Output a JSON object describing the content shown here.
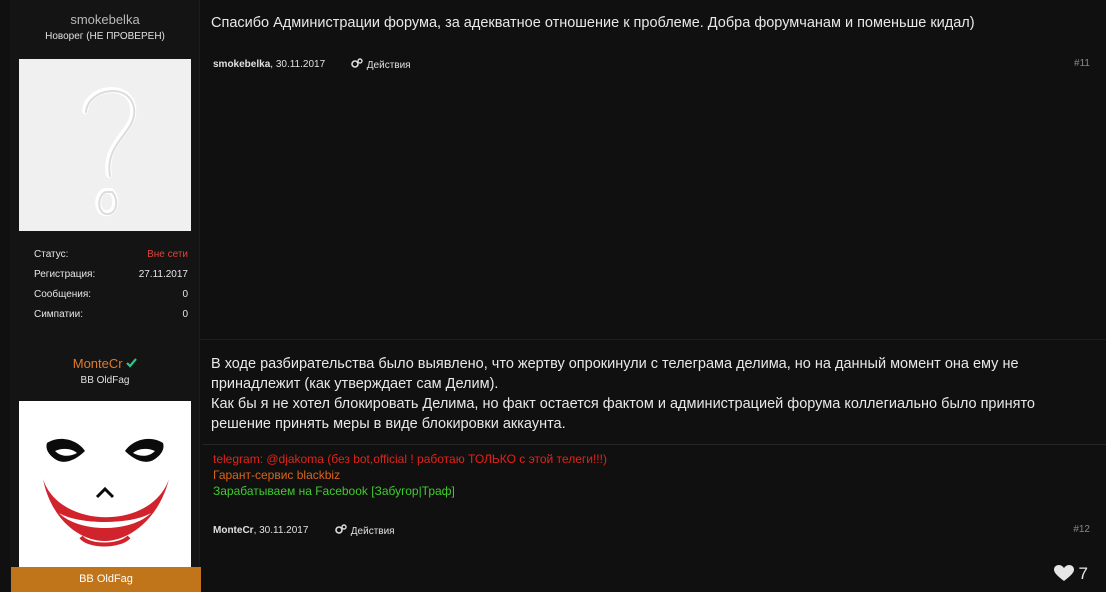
{
  "posts": [
    {
      "username": "smokebelka",
      "user_title": "Новорег (НЕ ПРОВЕРЕН)",
      "avatar_icon": "question-mark-avatar",
      "info": [
        {
          "label": "Статус:",
          "value": "Вне сети"
        },
        {
          "label": "Регистрация:",
          "value": "27.11.2017"
        },
        {
          "label": "Сообщения:",
          "value": "0"
        },
        {
          "label": "Симпатии:",
          "value": "0"
        }
      ],
      "message": "Спасибо Администрации форума, за адекватное отношение к проблеме. Добра форумчанам и поменьше кидал)",
      "meta_author": "smokebelka",
      "meta_date": ", 30.11.2017",
      "actions_label": "Действия",
      "post_number": "#11"
    },
    {
      "username": "MonteCr",
      "verified_icon": "checkmark-icon",
      "user_title": "BB OldFag",
      "avatar_icon": "joker-face-avatar",
      "rank_badge": "BB OldFag",
      "message_lines": [
        "В ходе разбирательства было выявлено, что жертву опрокинули с телеграма делима, но на данный момент она ему не",
        "принадлежит (как утверждает сам Делим).",
        "Как бы я не хотел блокировать Делима, но факт остается фактом и администрацией форума коллегиально было принято",
        "решение принять меры в виде блокировки аккаунта."
      ],
      "signature": {
        "telegram": "telegram: @djakoma (без bot,official ! работаю ТОЛЬКО с этой телеги!!!)",
        "garant": "Гарант-сервис blackbiz",
        "facebook": "Зарабатываем на Facebook [Забугор|Траф]"
      },
      "meta_author": "MonteCr",
      "meta_date": ", 30.11.2017",
      "actions_label": "Действия",
      "post_number": "#12",
      "likes_count": "7"
    }
  ],
  "colors": {
    "background": "#101010",
    "sidebar": "#141414",
    "username_primary": "#b8b8b8",
    "username_staff": "#e07b2a",
    "offline": "#e0433a",
    "verified": "#2fc48a",
    "badge": "#c0751b",
    "sig_telegram": "#e2231a",
    "sig_garant": "#d8651c",
    "sig_facebook": "#3fcc2e"
  }
}
